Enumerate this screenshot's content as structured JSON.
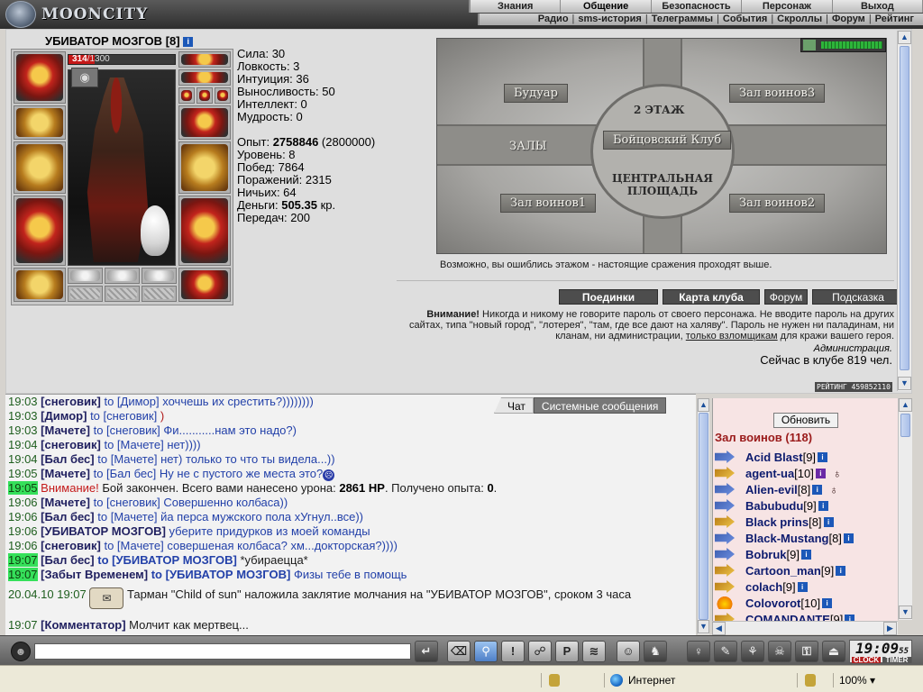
{
  "app": {
    "logo_text": "MOONCITY"
  },
  "top_menu": {
    "primary": [
      "Знания",
      "Общение",
      "Безопасность",
      "Персонаж",
      "Выход"
    ],
    "primary_selected": "Общение",
    "secondary": [
      "Радио",
      "sms-история",
      "Телеграммы",
      "События",
      "Скроллы",
      "Форум",
      "Рейтинг"
    ]
  },
  "character": {
    "name": "УБИВАТОР МОЗГОВ",
    "level": "[8]",
    "hp_current": "314",
    "hp_max": "/1300",
    "hp_fraction": 0.242,
    "stats": {
      "strength": "Сила: 30",
      "agility": "Ловкость: 3",
      "intuition": "Интуиция: 36",
      "stamina": "Выносливость: 50",
      "intellect": "Интеллект: 0",
      "wisdom": "Мудрость: 0"
    },
    "experience_label": "Опыт: ",
    "experience_value": "2758846",
    "experience_next": " (2800000)",
    "level_line": "Уровень: 8",
    "wins": "Побед: 7864",
    "losses": "Поражений: 2315",
    "draws": "Ничьих: 64",
    "money_label": "Деньги: ",
    "money_value": "505.35",
    "money_unit": " кр.",
    "transfers": "Передач: 200"
  },
  "map": {
    "rooms": {
      "boudoir": "Будуар",
      "hall3": "Зал воинов3",
      "floor2": "2 ЭТАЖ",
      "fight_club": "Бойцовский Клуб",
      "halls": "ЗАЛЫ",
      "central_square": "ЦЕНТРАЛЬНАЯ ПЛОЩАДЬ",
      "hall1": "Зал воинов1",
      "hall2": "Зал воинов2"
    },
    "note": "Возможно, вы ошиблись этажом - настоящие сражения проходят выше."
  },
  "buttons": {
    "duels": "Поединки",
    "club_map": "Карта клуба",
    "forum": "Форум",
    "hint": "Подсказка"
  },
  "warning": {
    "label": "Внимание!",
    "text1": " Никогда и никому не говорите пароль от своего персонажа. Не вводите пароль на других сайтах, типа \"новый город\", \"лотерея\", \"там, где все дают на халяву\". Пароль не нужен ни паладинам, ни кланам, ни администрации, ",
    "link": "только взломщикам",
    "text2": " для кражи вашего героя.",
    "admin": "Администрация.",
    "online": "Сейчас в клубе 819 чел."
  },
  "rating_counter": "РЕЙТИНГ 459852110",
  "chat_tabs": {
    "chat": "Чат",
    "system": "Системные сообщения"
  },
  "chat": [
    {
      "time": "19:03",
      "nick": "снеговик",
      "to": "Димор",
      "text": " хоччешь их срестить?))))))))",
      "style": "msg"
    },
    {
      "time": "19:03",
      "nick": "Димор",
      "to": "снеговик",
      "text": " )",
      "style": "msg-r"
    },
    {
      "time": "19:03",
      "nick": "Мачете",
      "to": "снеговик",
      "text": " Фи...........нам это надо?)",
      "style": "msg"
    },
    {
      "time": "19:04",
      "nick": "снеговик",
      "to": "Мачете",
      "text": " нет))))",
      "style": "msg"
    },
    {
      "time": "19:04",
      "nick": "Бал бес",
      "to": "Мачете",
      "text": " нет) только то что ты видела...))",
      "style": "msg"
    },
    {
      "time": "19:05",
      "nick": "Мачете",
      "to": "Бал бес",
      "text": " Ну не с пустого же места это?",
      "style": "msg"
    },
    {
      "time": "19:05",
      "system": true,
      "warn": "Внимание!",
      "text_a": " Бой закончен. Всего вами нанесено урона: ",
      "dmg": "2861 HP",
      "text_b": ". Получено опыта: ",
      "exp": "0",
      "text_c": "."
    },
    {
      "time": "19:06",
      "nick": "Мачете",
      "to": "снеговик",
      "text": " Совершенно колбаса))",
      "style": "msg"
    },
    {
      "time": "19:06",
      "nick": "Бал бес",
      "to": "Мачете",
      "text": " йа перса мужского пола хУгнул..все))",
      "style": "msg"
    },
    {
      "time": "19:06",
      "nick": "УБИВАТОР МОЗГОВ",
      "text": " уберите придурков из моей команды",
      "style": "msg"
    },
    {
      "time": "19:06",
      "nick": "снеговик",
      "to": "Мачете",
      "text": " совершеная колбаса? хм...докторская?))))",
      "style": "msg"
    },
    {
      "time": "19:07",
      "nick": "Бал бес",
      "to": "[УБИВАТОР МОЗГОВ]",
      "text": " *убираецца*",
      "style": "msg-k",
      "hl": true
    },
    {
      "time": "19:07",
      "nick": "Забыт Временем",
      "to": "[УБИВАТОР МОЗГОВ]",
      "text": " Физы тебе в помощь",
      "style": "msg",
      "hl": true
    },
    {
      "datetime": "20.04.10 19:07",
      "scroll": true,
      "text": " Тарман \"Child of sun\" наложила заклятие молчания на \"УБИВАТОР МОЗГОВ\", сроком 3 часа"
    },
    {
      "time": "19:07",
      "nick": "Комментатор",
      "text": " Молчит как мертвец...",
      "style": "msg-k"
    }
  ],
  "users": {
    "refresh": "Обновить",
    "room": "Зал воинов (118)",
    "list": [
      {
        "name": "Acid Blast",
        "level": "[9]",
        "align": "blue"
      },
      {
        "name": "agent-ua",
        "level": "[10]",
        "align": "gold",
        "info": "purple",
        "extra": "♁"
      },
      {
        "name": "Alien-evil",
        "level": "[8]",
        "align": "blue",
        "extra": "♁"
      },
      {
        "name": "Babubudu",
        "level": "[9]",
        "align": "blue"
      },
      {
        "name": "Black prins",
        "level": "[8]",
        "align": "gold"
      },
      {
        "name": "Black-Mustang",
        "level": "[8]",
        "align": "blue"
      },
      {
        "name": "Bobruk",
        "level": "[9]",
        "align": "blue"
      },
      {
        "name": "Cartoon_man",
        "level": "[9]",
        "align": "gold"
      },
      {
        "name": "colach",
        "level": "[9]",
        "align": "gold"
      },
      {
        "name": "Colovorot",
        "level": "[10]",
        "align": "flame"
      },
      {
        "name": "COMANDANTE",
        "level": "[9]",
        "align": "gold"
      }
    ]
  },
  "clock": {
    "time": "19:09",
    "seconds": "55",
    "clock_label": "CLOCK",
    "timer_label": "TIMER"
  },
  "statusbar": {
    "zone": "Интернет",
    "zoom": "100%"
  }
}
